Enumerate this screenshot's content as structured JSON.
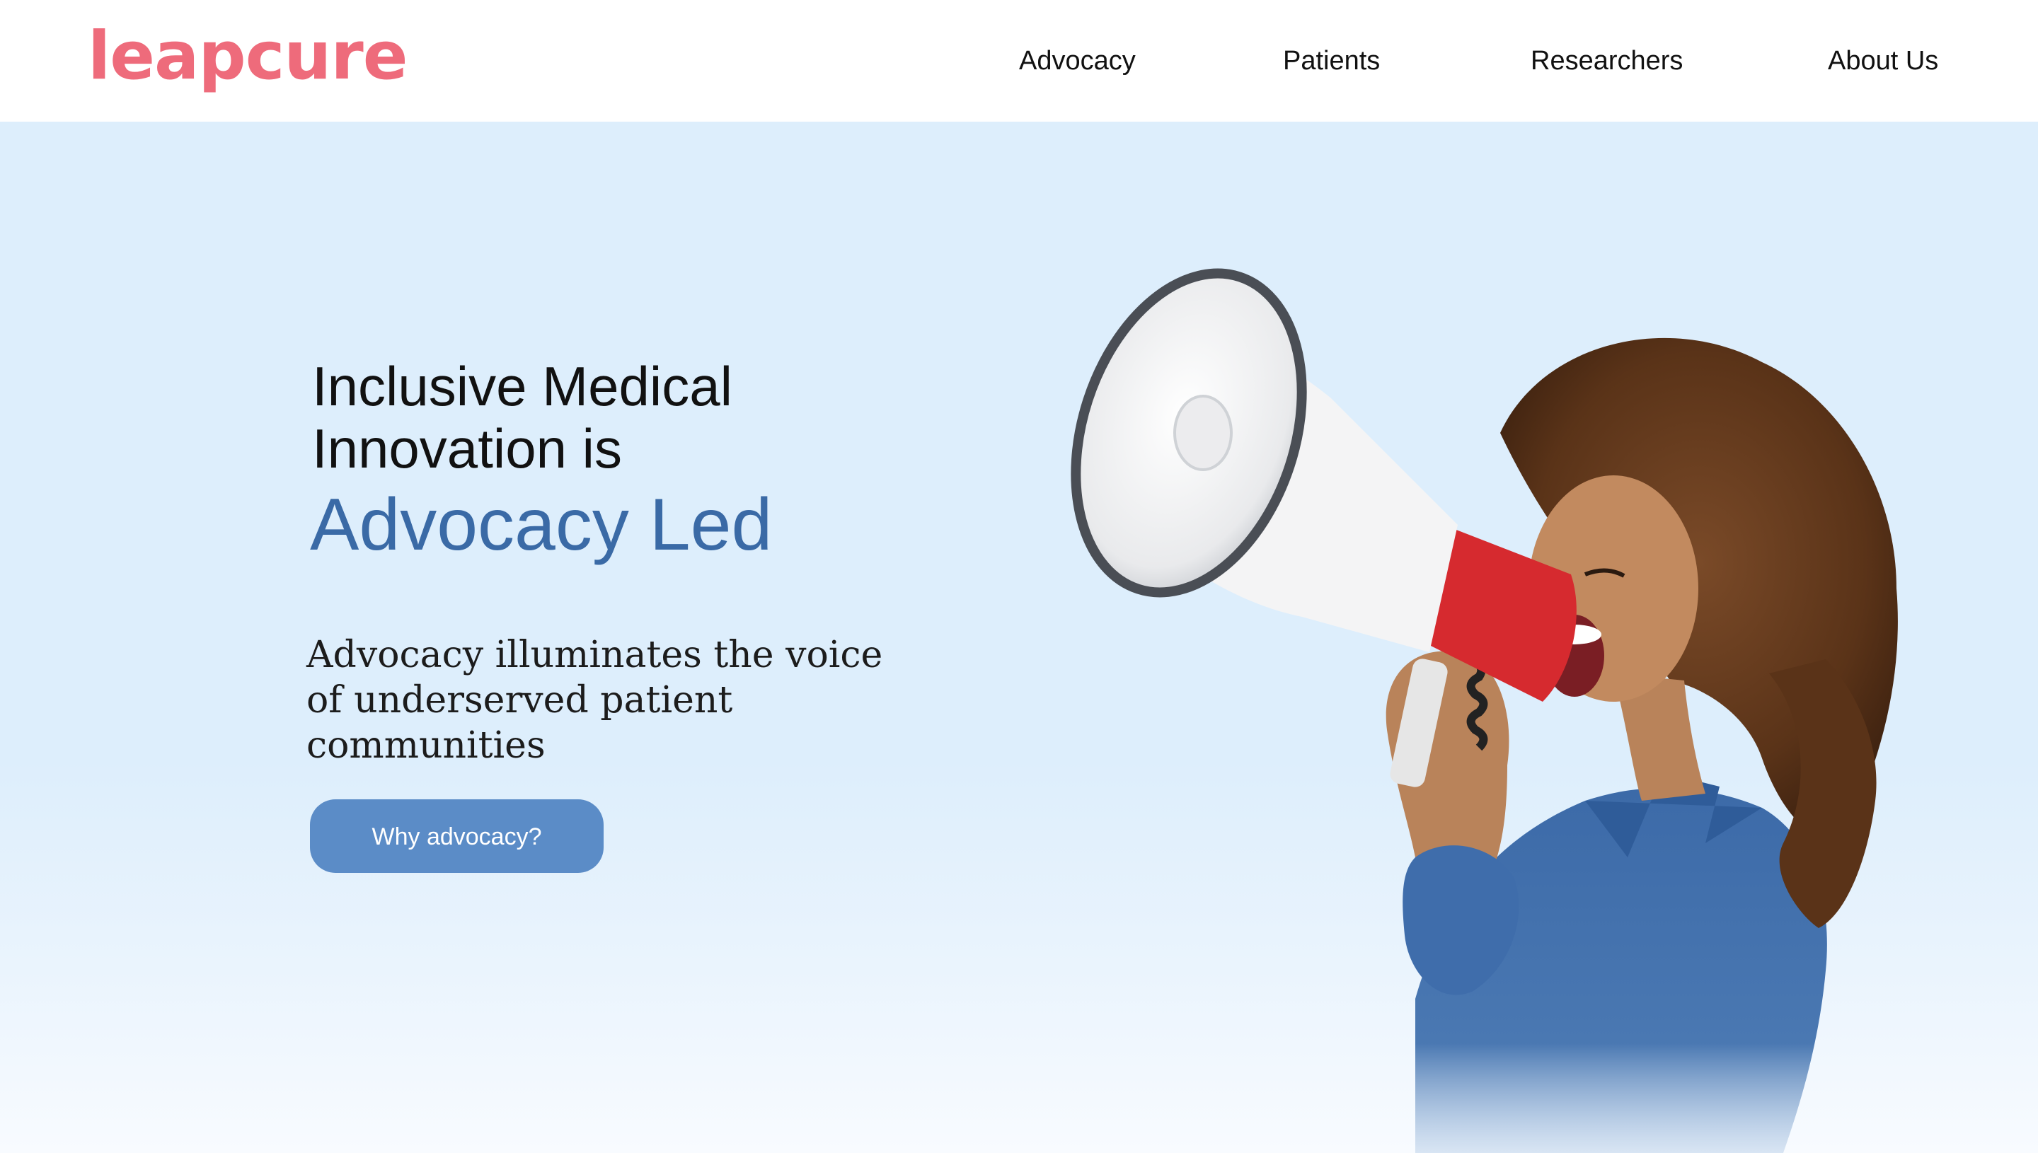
{
  "brand": {
    "logo_text": "leapcure",
    "logo_color": "#ee6b7b"
  },
  "nav": {
    "items": [
      {
        "label": "Advocacy"
      },
      {
        "label": "Patients"
      },
      {
        "label": "Researchers"
      },
      {
        "label": "About Us"
      }
    ]
  },
  "hero": {
    "headline": "Inclusive Medical Innovation is",
    "headline_accent": "Advocacy Led",
    "subtext": "Advocacy illuminates the voice of underserved patient communities",
    "cta_label": "Why advocacy?",
    "image_alt": "woman-shouting-into-megaphone",
    "accent_color": "#3a6aa6",
    "button_color": "#5b8cc7",
    "background_color": "#ddeefc"
  }
}
